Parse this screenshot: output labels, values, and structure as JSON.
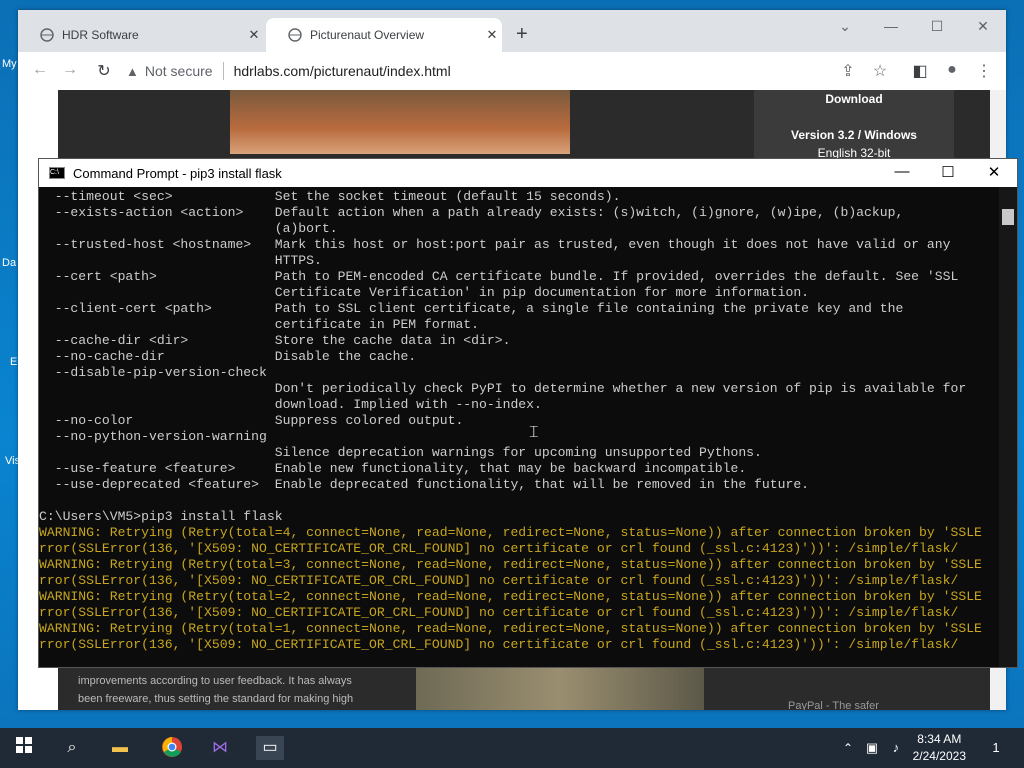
{
  "desktop": {
    "labels": [
      "My",
      "Da",
      "E",
      "Vis"
    ]
  },
  "browser": {
    "tabs": [
      {
        "title": "HDR Software",
        "active": false
      },
      {
        "title": "Picturenaut Overview",
        "active": true
      }
    ],
    "address": {
      "security_label": "Not secure",
      "url": "hdrlabs.com/picturenaut/index.html"
    },
    "page": {
      "download_heading": "Download",
      "version_label": "Version 3.2 / Windows",
      "english_link": "English 32-bit",
      "body_line1": "improvements according to user feedback. It has always",
      "body_line2": "been freeware, thus setting the standard for making high",
      "paypal_alt": "PayPal - The safer"
    }
  },
  "cmd": {
    "title": "Command Prompt - pip3  install flask",
    "lines": [
      {
        "t": "  --timeout <sec>             Set the socket timeout (default 15 seconds).",
        "w": false
      },
      {
        "t": "  --exists-action <action>    Default action when a path already exists: (s)witch, (i)gnore, (w)ipe, (b)ackup,",
        "w": false
      },
      {
        "t": "                              (a)bort.",
        "w": false
      },
      {
        "t": "  --trusted-host <hostname>   Mark this host or host:port pair as trusted, even though it does not have valid or any",
        "w": false
      },
      {
        "t": "                              HTTPS.",
        "w": false
      },
      {
        "t": "  --cert <path>               Path to PEM-encoded CA certificate bundle. If provided, overrides the default. See 'SSL",
        "w": false
      },
      {
        "t": "                              Certificate Verification' in pip documentation for more information.",
        "w": false
      },
      {
        "t": "  --client-cert <path>        Path to SSL client certificate, a single file containing the private key and the",
        "w": false
      },
      {
        "t": "                              certificate in PEM format.",
        "w": false
      },
      {
        "t": "  --cache-dir <dir>           Store the cache data in <dir>.",
        "w": false
      },
      {
        "t": "  --no-cache-dir              Disable the cache.",
        "w": false
      },
      {
        "t": "  --disable-pip-version-check",
        "w": false
      },
      {
        "t": "                              Don't periodically check PyPI to determine whether a new version of pip is available for",
        "w": false
      },
      {
        "t": "                              download. Implied with --no-index.",
        "w": false
      },
      {
        "t": "  --no-color                  Suppress colored output.",
        "w": false
      },
      {
        "t": "  --no-python-version-warning",
        "w": false
      },
      {
        "t": "                              Silence deprecation warnings for upcoming unsupported Pythons.",
        "w": false
      },
      {
        "t": "  --use-feature <feature>     Enable new functionality, that may be backward incompatible.",
        "w": false
      },
      {
        "t": "  --use-deprecated <feature>  Enable deprecated functionality, that will be removed in the future.",
        "w": false
      },
      {
        "t": "",
        "w": false
      },
      {
        "t": "C:\\Users\\VM5>pip3 install flask",
        "w": false
      },
      {
        "t": "WARNING: Retrying (Retry(total=4, connect=None, read=None, redirect=None, status=None)) after connection broken by 'SSLE",
        "w": true
      },
      {
        "t": "rror(SSLError(136, '[X509: NO_CERTIFICATE_OR_CRL_FOUND] no certificate or crl found (_ssl.c:4123)'))': /simple/flask/",
        "w": true
      },
      {
        "t": "WARNING: Retrying (Retry(total=3, connect=None, read=None, redirect=None, status=None)) after connection broken by 'SSLE",
        "w": true
      },
      {
        "t": "rror(SSLError(136, '[X509: NO_CERTIFICATE_OR_CRL_FOUND] no certificate or crl found (_ssl.c:4123)'))': /simple/flask/",
        "w": true
      },
      {
        "t": "WARNING: Retrying (Retry(total=2, connect=None, read=None, redirect=None, status=None)) after connection broken by 'SSLE",
        "w": true
      },
      {
        "t": "rror(SSLError(136, '[X509: NO_CERTIFICATE_OR_CRL_FOUND] no certificate or crl found (_ssl.c:4123)'))': /simple/flask/",
        "w": true
      },
      {
        "t": "WARNING: Retrying (Retry(total=1, connect=None, read=None, redirect=None, status=None)) after connection broken by 'SSLE",
        "w": true
      },
      {
        "t": "rror(SSLError(136, '[X509: NO_CERTIFICATE_OR_CRL_FOUND] no certificate or crl found (_ssl.c:4123)'))': /simple/flask/",
        "w": true
      }
    ]
  },
  "taskbar": {
    "time": "8:34 AM",
    "date": "2/24/2023",
    "notification_count": "1"
  },
  "colors": {
    "warning_text": "#c7a61e",
    "console_text": "#cccccc",
    "console_bg": "#0c0c0c"
  }
}
